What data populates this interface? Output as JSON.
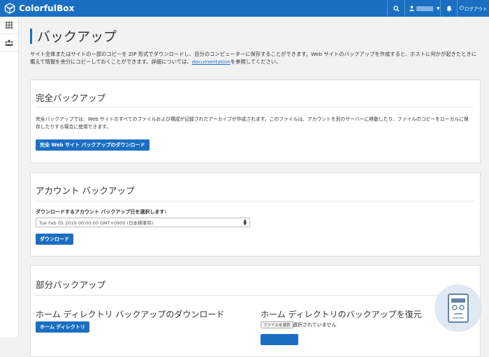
{
  "topbar": {
    "brand": "ColorfulBox",
    "logout_label": "ログアウト",
    "colors": {
      "bar": "#1b6fc2"
    }
  },
  "page": {
    "title": "バックアップ",
    "description_pre": "サイト全体またはサイトの一部のコピーを ZIP 形式でダウンロードし、自分のコンピューターに保存することができます。Web サイトのバックアップを作成すると、ホストに何かが起きたときに備えて情報を余分にコピーしておくことができます。詳細については、",
    "description_link": "documentation",
    "description_post": "を参照してください。"
  },
  "full_backup": {
    "title": "完全バックアップ",
    "text": "完全バックアップでは、Web サイトのすべてのファイルおよび構成が記録されたアーカイブが作成されます。このファイルは、アカウントを別のサーバーに移動したり、ファイルのコピーをローカルに保存したりする場合に使用できます。",
    "button": "完全 Web サイト バックアップのダウンロード"
  },
  "account_backup": {
    "title": "アカウント バックアップ",
    "select_label": "ダウンロードするアカウント バックアップ日を選択します:",
    "select_value": "Tue Feb 05 2019 00:00:00 GMT+0900 (日本標準時)",
    "button": "ダウンロード"
  },
  "partial_backup": {
    "title": "部分バックアップ",
    "home_download_title": "ホーム ディレクトリ バックアップのダウンロード",
    "home_download_button": "ホーム ディレクトリ",
    "home_restore_title": "ホーム ディレクトリのバックアップを復元",
    "file_button": "ファイルを選択",
    "file_status": "選択されていません"
  }
}
